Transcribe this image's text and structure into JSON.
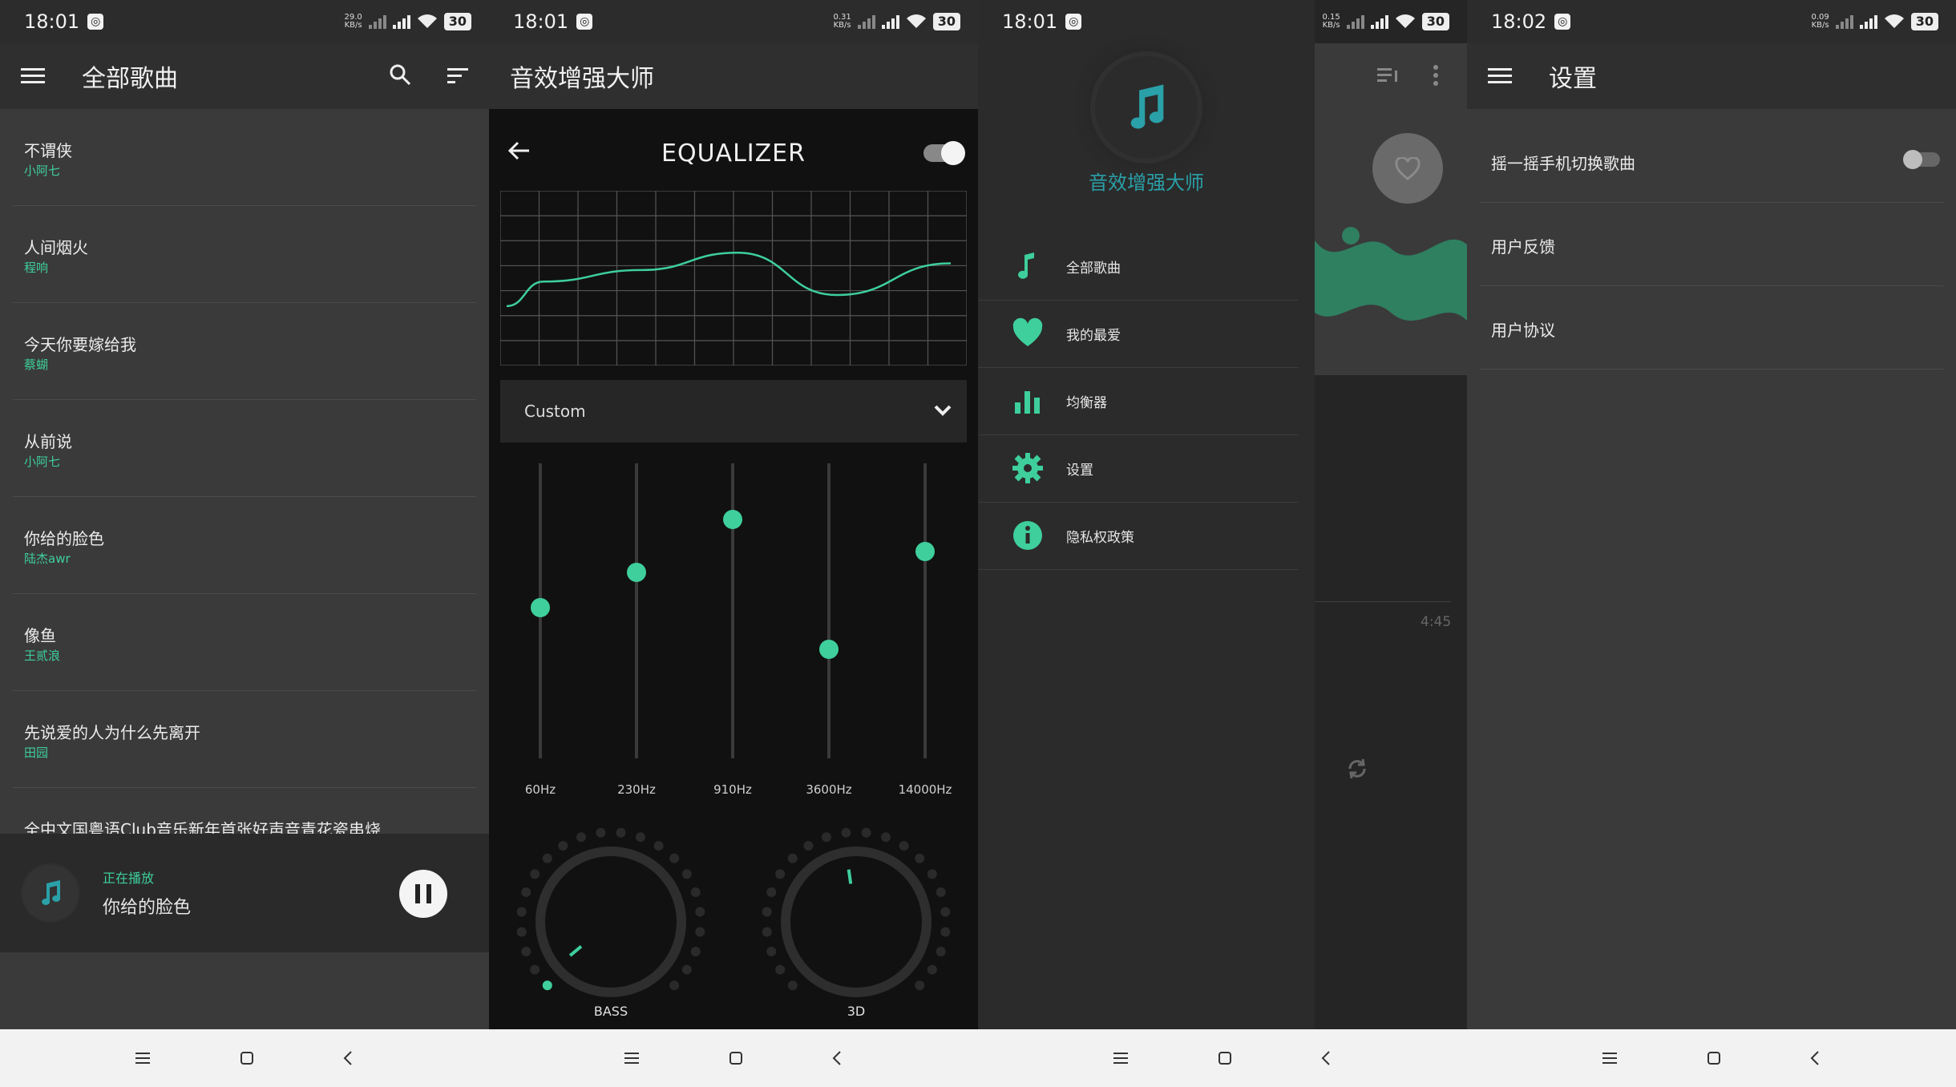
{
  "status_bars": [
    {
      "time": "18:01",
      "speed_top": "29.0",
      "speed_bottom": "KB/s",
      "battery": "30"
    },
    {
      "time": "18:01",
      "speed_top": "0.31",
      "speed_bottom": "KB/s",
      "battery": "30"
    },
    {
      "time": "18:01",
      "speed_top": "0.15",
      "speed_bottom": "KB/s",
      "battery": "30"
    },
    {
      "time": "18:02",
      "speed_top": "0.09",
      "speed_bottom": "KB/s",
      "battery": "30"
    }
  ],
  "screen1": {
    "title": "全部歌曲",
    "songs": [
      {
        "name": "不谓侠",
        "artist": "小阿七"
      },
      {
        "name": "人间烟火",
        "artist": "程响"
      },
      {
        "name": "今天你要嫁给我",
        "artist": "蔡蝴"
      },
      {
        "name": "从前说",
        "artist": "小阿七"
      },
      {
        "name": "你给的脸色",
        "artist": "陆杰awr"
      },
      {
        "name": "像鱼",
        "artist": "王贰浪"
      },
      {
        "name": "先说爱的人为什么先离开",
        "artist": "田园"
      },
      {
        "name": "全中文国粤语Club音乐新年首张好声音青花瓷串烧",
        "artist": ""
      }
    ],
    "now_playing_label": "正在播放",
    "now_playing_song": "你给的脸色"
  },
  "screen2": {
    "app_title": "音效增强大师",
    "eq_title": "EQUALIZER",
    "enabled": true,
    "preset": "Custom",
    "bands": [
      {
        "label": "60Hz",
        "level": 0.51
      },
      {
        "label": "230Hz",
        "level": 0.63
      },
      {
        "label": "910Hz",
        "level": 0.81
      },
      {
        "label": "3600Hz",
        "level": 0.37
      },
      {
        "label": "14000Hz",
        "level": 0.7
      }
    ],
    "knobs": [
      {
        "label": "BASS",
        "level": 0.02
      },
      {
        "label": "3D",
        "level": 0.47
      }
    ]
  },
  "screen3": {
    "app_name": "音效增强大师",
    "menu": [
      {
        "label": "全部歌曲",
        "icon": "music-note-icon"
      },
      {
        "label": "我的最爱",
        "icon": "heart-icon"
      },
      {
        "label": "均衡器",
        "icon": "equalizer-bars-icon"
      },
      {
        "label": "设置",
        "icon": "gear-icon"
      },
      {
        "label": "隐私权政策",
        "icon": "info-icon"
      }
    ],
    "behind_duration": "4:45"
  },
  "screen4": {
    "title": "设置",
    "rows": [
      {
        "label": "摇一摇手机切换歌曲",
        "toggle": false
      },
      {
        "label": "用户反馈"
      },
      {
        "label": "用户协议"
      }
    ]
  },
  "colors": {
    "accent": "#3ecf9c",
    "teal_logo": "#2aa0a8"
  }
}
